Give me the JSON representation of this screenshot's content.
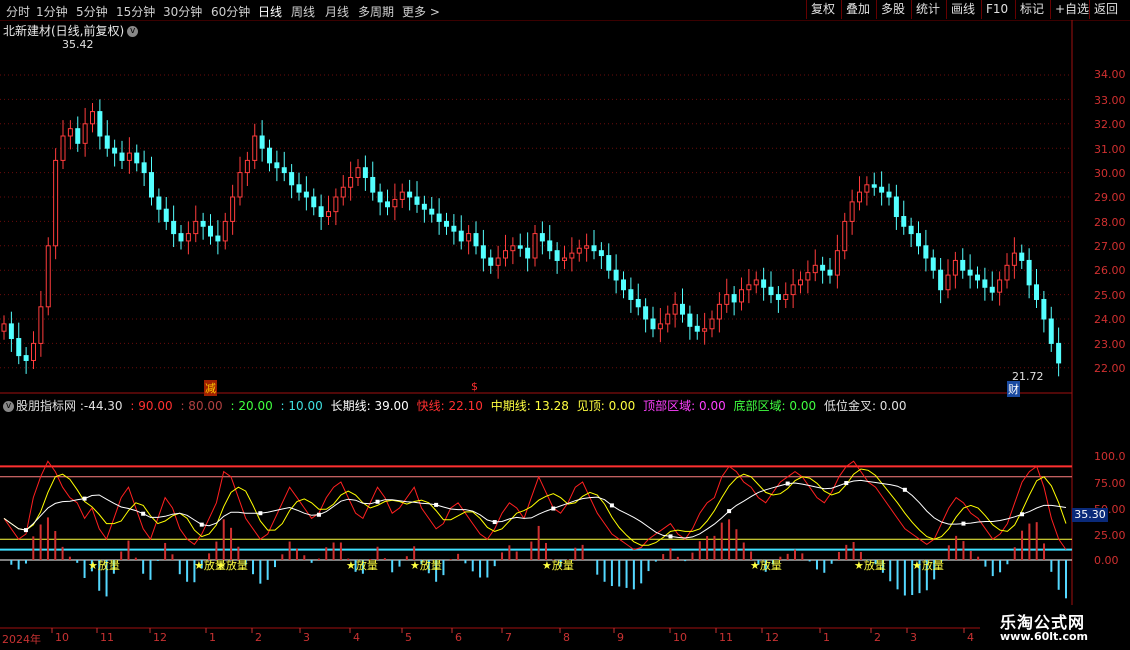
{
  "toolbar": {
    "timeframes": [
      "分时",
      "1分钟",
      "5分钟",
      "15分钟",
      "30分钟",
      "60分钟",
      "日线",
      "周线",
      "月线",
      "多周期",
      "更多 >"
    ],
    "active_timeframe": "日线",
    "buttons": [
      "复权",
      "叠加",
      "多股",
      "统计",
      "画线",
      "F10",
      "标记",
      "+自选",
      "返回"
    ]
  },
  "stock": {
    "title": "北新建材(日线,前复权)",
    "high_label": "35.42",
    "low_label": "21.72",
    "marker_cai": "财",
    "marker_cut": "减",
    "marker_dollar": "$"
  },
  "price_axis": [
    "34.00",
    "33.00",
    "32.00",
    "31.00",
    "30.00",
    "29.00",
    "28.00",
    "27.00",
    "26.00",
    "25.00",
    "24.00",
    "23.00",
    "22.00"
  ],
  "indicator": {
    "name": "股朋指标网",
    "value": ":-44.30",
    "v90": ": 90.00",
    "v80": ": 80.00",
    "v20": ": 20.00",
    "v10": ": 10.00",
    "long_line": "长期线: 39.00",
    "fast_line": "快线: 22.10",
    "mid_line": "中期线: 13.28",
    "jian_ding": "见顶: 0.00",
    "top_zone": "顶部区域: 0.00",
    "bottom_zone": "底部区域: 0.00",
    "low_golden": "低位金叉: 0.00",
    "current_value": "35.30",
    "fangliang_label": "★放量"
  },
  "indicator_axis": [
    "100.0",
    "75.00",
    "50.00",
    "25.00",
    "0.00"
  ],
  "dates": [
    "2024年",
    "10",
    "11",
    "12",
    "1",
    "2",
    "3",
    "4",
    "5",
    "6",
    "7",
    "8",
    "9",
    "10",
    "11",
    "12",
    "1",
    "2",
    "3",
    "4"
  ],
  "watermark": {
    "line1": "乐淘公式网",
    "line2": "www.60lt.com"
  },
  "colors": {
    "up": "#ff3c3c",
    "down": "#54ffff",
    "axis": "#c83232",
    "yellow": "#ffff00",
    "white": "#ffffff"
  },
  "chart_data": {
    "type": "candlestick",
    "price_close": [
      23.8,
      23.2,
      22.5,
      22.3,
      23.0,
      24.5,
      27.0,
      30.5,
      31.5,
      31.8,
      31.2,
      32.0,
      32.5,
      31.5,
      31.0,
      30.8,
      30.5,
      30.8,
      30.4,
      30.0,
      29.0,
      28.5,
      28.0,
      27.5,
      27.2,
      27.5,
      28.0,
      27.8,
      27.4,
      27.2,
      28.0,
      29.0,
      30.0,
      30.5,
      31.5,
      31.0,
      30.4,
      30.2,
      30.0,
      29.5,
      29.2,
      29.0,
      28.6,
      28.2,
      28.4,
      29.0,
      29.4,
      29.8,
      30.2,
      29.8,
      29.2,
      28.8,
      28.6,
      28.9,
      29.2,
      29.0,
      28.7,
      28.5,
      28.3,
      28.0,
      27.8,
      27.6,
      27.2,
      27.5,
      27.0,
      26.5,
      26.2,
      26.5,
      26.8,
      27.0,
      26.9,
      26.5,
      27.5,
      27.2,
      26.8,
      26.4,
      26.5,
      26.7,
      26.9,
      27.0,
      26.8,
      26.6,
      26.0,
      25.6,
      25.2,
      24.8,
      24.5,
      24.0,
      23.6,
      23.8,
      24.2,
      24.6,
      24.2,
      23.7,
      23.5,
      23.6,
      24.0,
      24.6,
      25.0,
      24.7,
      25.2,
      25.4,
      25.6,
      25.3,
      25.0,
      24.8,
      25.0,
      25.4,
      25.6,
      25.9,
      26.2,
      26.0,
      25.8,
      26.8,
      28.0,
      28.8,
      29.2,
      29.5,
      29.4,
      29.2,
      29.0,
      28.2,
      27.8,
      27.5,
      27.0,
      26.5,
      26.0,
      25.2,
      25.8,
      26.4,
      26.0,
      25.8,
      25.6,
      25.3,
      25.1,
      25.6,
      26.2,
      26.7,
      26.4,
      25.4,
      24.8,
      24.0,
      23.0,
      22.2
    ],
    "indicator_fast": [
      40,
      30,
      20,
      25,
      60,
      80,
      95,
      85,
      70,
      60,
      55,
      40,
      50,
      30,
      20,
      40,
      60,
      70,
      50,
      30,
      20,
      40,
      60,
      50,
      30,
      20,
      15,
      25,
      40,
      55,
      85,
      80,
      60,
      40,
      30,
      20,
      25,
      40,
      55,
      70,
      60,
      50,
      40,
      45,
      60,
      70,
      75,
      60,
      45,
      40,
      55,
      70,
      60,
      45,
      50,
      60,
      70,
      50,
      40,
      30,
      35,
      50,
      55,
      45,
      35,
      25,
      20,
      30,
      45,
      55,
      50,
      40,
      60,
      80,
      65,
      50,
      45,
      55,
      70,
      75,
      60,
      45,
      35,
      25,
      20,
      15,
      10,
      12,
      20,
      25,
      30,
      35,
      25,
      20,
      30,
      45,
      55,
      60,
      80,
      90,
      85,
      75,
      70,
      60,
      55,
      65,
      75,
      80,
      85,
      80,
      70,
      60,
      55,
      65,
      80,
      90,
      95,
      85,
      75,
      70,
      60,
      50,
      40,
      30,
      25,
      20,
      15,
      20,
      35,
      50,
      60,
      55,
      45,
      40,
      30,
      20,
      25,
      35,
      55,
      75,
      85,
      90,
      70,
      40,
      20,
      10
    ],
    "indicator_ylim": [
      -40,
      100
    ]
  }
}
